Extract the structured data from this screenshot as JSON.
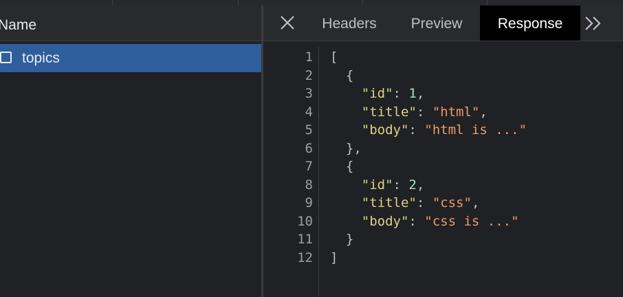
{
  "sidebar": {
    "header": "Name",
    "items": [
      {
        "label": "topics",
        "selected": true
      }
    ]
  },
  "tabs": [
    {
      "label": "Headers",
      "active": false
    },
    {
      "label": "Preview",
      "active": false
    },
    {
      "label": "Response",
      "active": true
    }
  ],
  "icons": {
    "close": "close-icon",
    "more": "chevron-double-right-icon",
    "file": "file-icon"
  },
  "colors": {
    "selected_row": "#2e5e9c",
    "active_tab_bg": "#000000",
    "json_key": "#dbd386",
    "json_string": "#ec9a6a",
    "json_number": "#9fe6b9"
  },
  "response": {
    "lines": [
      {
        "num": "1",
        "tokens": [
          {
            "t": "p",
            "v": "["
          }
        ]
      },
      {
        "num": "2",
        "tokens": [
          {
            "t": "p",
            "v": "  {"
          }
        ]
      },
      {
        "num": "3",
        "tokens": [
          {
            "t": "p",
            "v": "    "
          },
          {
            "t": "k",
            "v": "\"id\""
          },
          {
            "t": "p",
            "v": ": "
          },
          {
            "t": "n",
            "v": "1"
          },
          {
            "t": "p",
            "v": ","
          }
        ]
      },
      {
        "num": "4",
        "tokens": [
          {
            "t": "p",
            "v": "    "
          },
          {
            "t": "k",
            "v": "\"title\""
          },
          {
            "t": "p",
            "v": ": "
          },
          {
            "t": "s",
            "v": "\"html\""
          },
          {
            "t": "p",
            "v": ","
          }
        ]
      },
      {
        "num": "5",
        "tokens": [
          {
            "t": "p",
            "v": "    "
          },
          {
            "t": "k",
            "v": "\"body\""
          },
          {
            "t": "p",
            "v": ": "
          },
          {
            "t": "s",
            "v": "\"html is ...\""
          }
        ]
      },
      {
        "num": "6",
        "tokens": [
          {
            "t": "p",
            "v": "  },"
          }
        ]
      },
      {
        "num": "7",
        "tokens": [
          {
            "t": "p",
            "v": "  {"
          }
        ]
      },
      {
        "num": "8",
        "tokens": [
          {
            "t": "p",
            "v": "    "
          },
          {
            "t": "k",
            "v": "\"id\""
          },
          {
            "t": "p",
            "v": ": "
          },
          {
            "t": "n",
            "v": "2"
          },
          {
            "t": "p",
            "v": ","
          }
        ]
      },
      {
        "num": "9",
        "tokens": [
          {
            "t": "p",
            "v": "    "
          },
          {
            "t": "k",
            "v": "\"title\""
          },
          {
            "t": "p",
            "v": ": "
          },
          {
            "t": "s",
            "v": "\"css\""
          },
          {
            "t": "p",
            "v": ","
          }
        ]
      },
      {
        "num": "10",
        "tokens": [
          {
            "t": "p",
            "v": "    "
          },
          {
            "t": "k",
            "v": "\"body\""
          },
          {
            "t": "p",
            "v": ": "
          },
          {
            "t": "s",
            "v": "\"css is ...\""
          }
        ]
      },
      {
        "num": "11",
        "tokens": [
          {
            "t": "p",
            "v": "  }"
          }
        ]
      },
      {
        "num": "12",
        "tokens": [
          {
            "t": "p",
            "v": "]"
          }
        ]
      }
    ]
  }
}
